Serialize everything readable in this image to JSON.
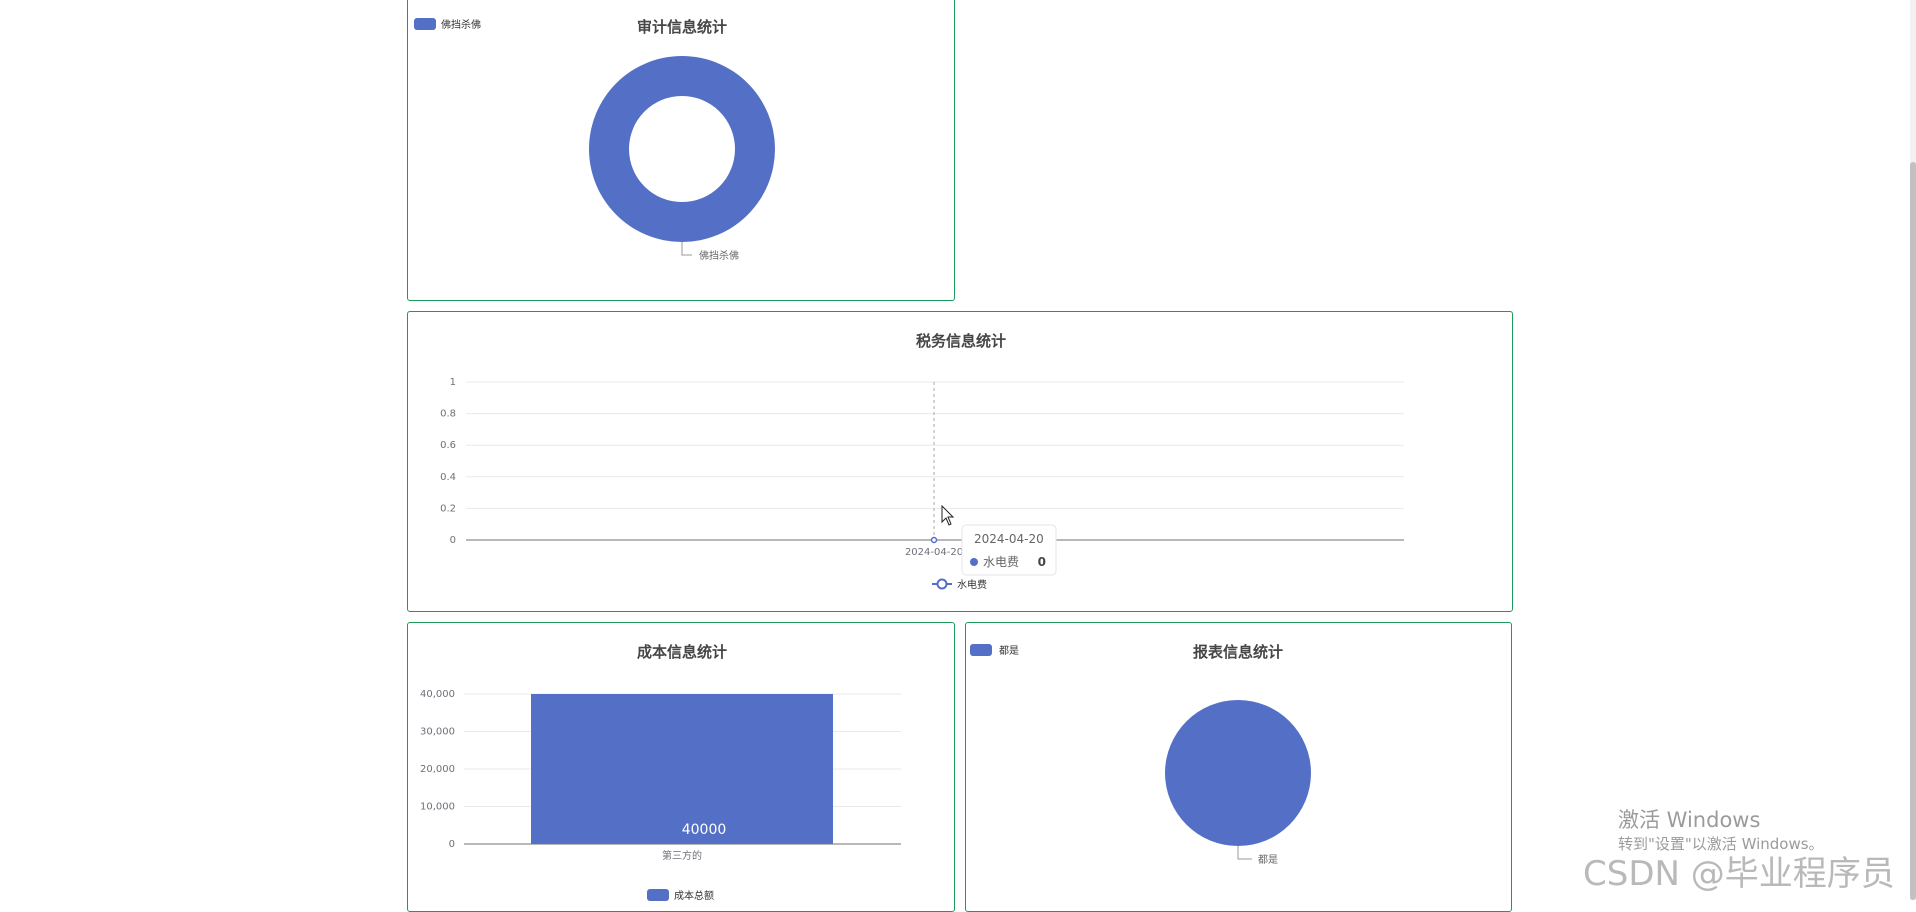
{
  "colors": {
    "accent": "#5470c6",
    "border": "#1b9a5c",
    "grid": "#e9e9e9",
    "axis": "#6e7079"
  },
  "chart_data": [
    {
      "id": "audit",
      "type": "pie",
      "variant": "donut",
      "title": "审计信息统计",
      "legend": {
        "position": "top-left",
        "items": [
          "佛挡杀佛"
        ]
      },
      "slices": [
        {
          "name": "佛挡杀佛",
          "value": 1
        }
      ],
      "slice_labels": [
        "佛挡杀佛"
      ]
    },
    {
      "id": "tax",
      "type": "line",
      "title": "税务信息统计",
      "x": [
        "2024-04-20"
      ],
      "series": [
        {
          "name": "水电费",
          "values": [
            0
          ]
        }
      ],
      "ylim": [
        0,
        1
      ],
      "yticks": [
        "1",
        "0.8",
        "0.6",
        "0.4",
        "0.2",
        "0"
      ],
      "xtick_label": "2024-04-20",
      "grid": true,
      "legend": {
        "position": "bottom-center",
        "items": [
          "水电费"
        ]
      },
      "tooltip": {
        "title": "2024-04-20",
        "series": "水电费",
        "value": "0"
      }
    },
    {
      "id": "cost",
      "type": "bar",
      "title": "成本信息统计",
      "categories": [
        "第三方的"
      ],
      "series": [
        {
          "name": "成本总额",
          "values": [
            40000
          ]
        }
      ],
      "ylim": [
        0,
        40000
      ],
      "yticks": [
        "40,000",
        "30,000",
        "20,000",
        "10,000",
        "0"
      ],
      "data_label": "40000",
      "grid": true,
      "legend": {
        "position": "bottom-center",
        "items": [
          "成本总额"
        ]
      }
    },
    {
      "id": "report",
      "type": "pie",
      "title": "报表信息统计",
      "legend": {
        "position": "top-left",
        "items": [
          "都是"
        ]
      },
      "slices": [
        {
          "name": "都是",
          "value": 1
        }
      ],
      "slice_labels": [
        "都是"
      ]
    }
  ],
  "watermark": {
    "activation_title": "激活 Windows",
    "activation_sub": "转到\"设置\"以激活 Windows。",
    "csdn": "CSDN @毕业程序员"
  }
}
